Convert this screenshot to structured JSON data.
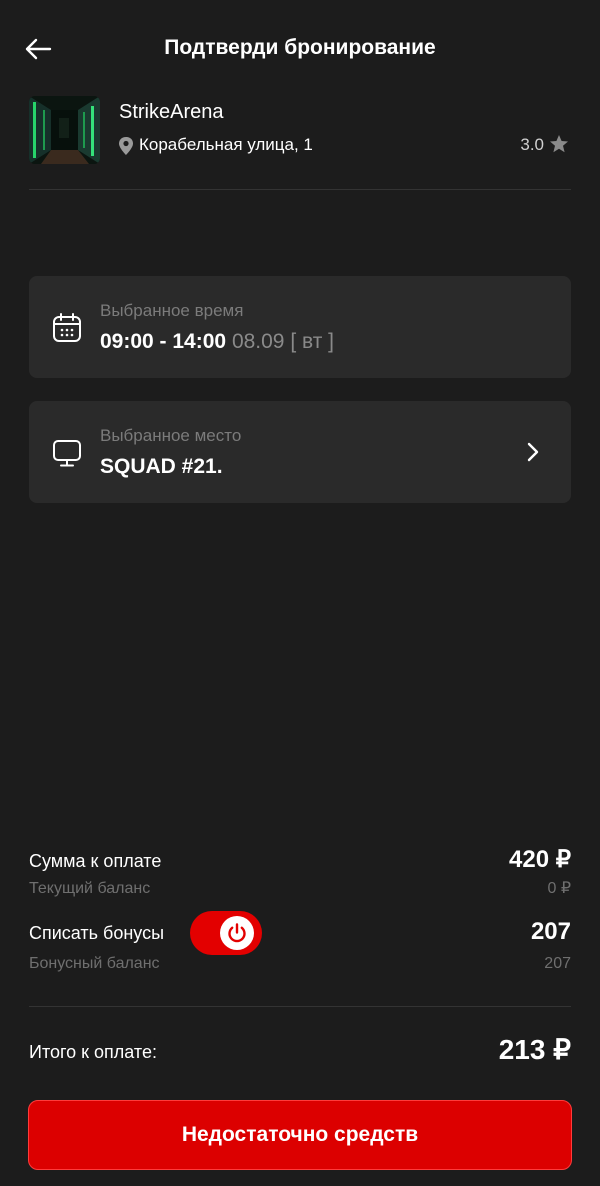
{
  "header": {
    "title": "Подтверди бронирование"
  },
  "venue": {
    "name": "StrikeArena",
    "address": "Корабельная улица, 1",
    "rating": "3.0"
  },
  "time_card": {
    "label": "Выбранное время",
    "time": "09:00 - 14:00",
    "date": "08.09",
    "weekday": "[ вт ]"
  },
  "seat_card": {
    "label": "Выбранное место",
    "value": "SQUAD #21."
  },
  "payment": {
    "sum_label": "Сумма к оплате",
    "sum_value": "420 ₽",
    "balance_label": "Текущий баланс",
    "balance_value": "0 ₽",
    "bonus_label": "Списать бонусы",
    "bonus_value": "207",
    "bonus_balance_label": "Бонусный баланс",
    "bonus_balance_value": "207",
    "bonus_toggle_on": true,
    "total_label": "Итого к оплате:",
    "total_value": "213 ₽"
  },
  "cta": {
    "label": "Недостаточно средств"
  },
  "colors": {
    "background": "#1c1c1c",
    "card": "#2a2a2a",
    "accent": "#dc0000",
    "muted": "#7b7b7b"
  },
  "icons": [
    "back-arrow-icon",
    "location-pin-icon",
    "star-icon",
    "calendar-icon",
    "monitor-icon",
    "chevron-right-icon",
    "power-icon"
  ]
}
